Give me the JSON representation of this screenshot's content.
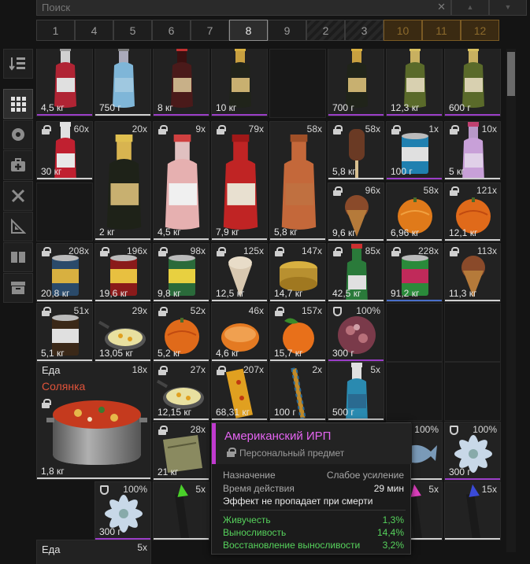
{
  "search": {
    "placeholder": "Поиск",
    "clear": "✕"
  },
  "sort_buttons": [
    "▲",
    "▼"
  ],
  "pages": [
    {
      "label": "1",
      "state": "normal"
    },
    {
      "label": "4",
      "state": "normal"
    },
    {
      "label": "5",
      "state": "normal"
    },
    {
      "label": "6",
      "state": "normal"
    },
    {
      "label": "7",
      "state": "normal"
    },
    {
      "label": "8",
      "state": "active"
    },
    {
      "label": "9",
      "state": "normal"
    },
    {
      "label": "2",
      "state": "striped"
    },
    {
      "label": "3",
      "state": "striped"
    },
    {
      "label": "10",
      "state": "locked"
    },
    {
      "label": "11",
      "state": "locked"
    },
    {
      "label": "12",
      "state": "locked"
    }
  ],
  "sidebar": [
    {
      "name": "sort-icon",
      "active": false
    },
    {
      "name": "grid-icon",
      "active": true
    },
    {
      "name": "ball-icon",
      "active": false
    },
    {
      "name": "medkit-icon",
      "active": false
    },
    {
      "name": "tools-icon",
      "active": false
    },
    {
      "name": "blueprint-icon",
      "active": false
    },
    {
      "name": "book-icon",
      "active": false
    },
    {
      "name": "storage-icon",
      "active": false
    }
  ],
  "colors": {
    "accent_purple": "#c13ad0",
    "rarity_purple": "#9b3ec8",
    "rarity_blue": "#4a6fc9",
    "rarity_white": "#d0d0d0",
    "rarity_orange": "#d27b2a",
    "positive_green": "#56d25c"
  },
  "items": [
    {
      "id": "c1",
      "weight": "4,5 кг",
      "qty": "",
      "lock": "",
      "art": "bottle-red",
      "bar": "purple"
    },
    {
      "id": "c2",
      "weight": "750 г",
      "qty": "",
      "lock": "",
      "art": "bottle-blue",
      "bar": "white"
    },
    {
      "id": "c3",
      "weight": "8 кг",
      "qty": "",
      "lock": "",
      "art": "bottle-wine",
      "bar": "purple"
    },
    {
      "id": "c4",
      "weight": "10 кг",
      "qty": "",
      "lock": "",
      "art": "bottle-gold",
      "bar": "purple"
    },
    {
      "id": "c6",
      "weight": "700 г",
      "qty": "",
      "lock": "",
      "art": "bottle-gold",
      "bar": "purple"
    },
    {
      "id": "c7",
      "weight": "12,3 кг",
      "qty": "",
      "lock": "",
      "art": "bottle-green",
      "bar": "purple"
    },
    {
      "id": "c8",
      "weight": "600 г",
      "qty": "",
      "lock": "",
      "art": "bottle-green",
      "bar": "purple"
    },
    {
      "id": "r2c1",
      "weight": "30 кг",
      "qty": "60x",
      "lock": "lock",
      "art": "sauce",
      "bar": "white"
    },
    {
      "id": "r2c2",
      "weight": "2 кг",
      "qty": "20x",
      "lock": "",
      "art": "bottle-gold-tall",
      "bar": "white"
    },
    {
      "id": "r2c3",
      "weight": "4,5 кг",
      "qty": "9x",
      "lock": "lock",
      "art": "bottle-pink",
      "bar": "white"
    },
    {
      "id": "r2c4",
      "weight": "7,9 кг",
      "qty": "79x",
      "lock": "lock",
      "art": "bottle-vodka",
      "bar": "white"
    },
    {
      "id": "r2c5",
      "weight": "5,8 кг",
      "qty": "58x",
      "lock": "",
      "art": "bottle-clay",
      "bar": "white"
    },
    {
      "id": "r2c6",
      "weight": "5,8 кг",
      "qty": "58x",
      "lock": "lock",
      "art": "popsicle",
      "bar": "white"
    },
    {
      "id": "r2c7",
      "weight": "100 г",
      "qty": "1x",
      "lock": "lock",
      "art": "can-blue",
      "bar": "purple"
    },
    {
      "id": "r2c8",
      "weight": "5 кг",
      "qty": "10x",
      "lock": "lock",
      "art": "bottle-lilac",
      "bar": "white"
    },
    {
      "id": "r3c6",
      "weight": "9,6 кг",
      "qty": "96x",
      "lock": "lock",
      "art": "icecream",
      "bar": "white"
    },
    {
      "id": "r3c7",
      "weight": "6,96 кг",
      "qty": "58x",
      "lock": "",
      "art": "orange-big",
      "bar": "white"
    },
    {
      "id": "r3c8",
      "weight": "12,1 кг",
      "qty": "121x",
      "lock": "lock",
      "art": "tangerine",
      "bar": "white"
    },
    {
      "id": "r4c1",
      "weight": "20,8 кг",
      "qty": "208x",
      "lock": "lock",
      "art": "can-beans",
      "bar": "white"
    },
    {
      "id": "r4c2",
      "weight": "19,6 кг",
      "qty": "196x",
      "lock": "lock",
      "art": "can-red",
      "bar": "white"
    },
    {
      "id": "r4c3",
      "weight": "9,8 кг",
      "qty": "98x",
      "lock": "lock",
      "art": "can-green",
      "bar": "white"
    },
    {
      "id": "r4c4",
      "weight": "12,5 кг",
      "qty": "125x",
      "lock": "lock",
      "art": "cone",
      "bar": "white"
    },
    {
      "id": "r4c5",
      "weight": "14,7 кг",
      "qty": "147x",
      "lock": "lock",
      "art": "tin",
      "bar": "white"
    },
    {
      "id": "r4c6",
      "weight": "42,5 кг",
      "qty": "85x",
      "lock": "lock",
      "art": "bottle-water",
      "bar": "white"
    },
    {
      "id": "r4c7",
      "weight": "91,2 кг",
      "qty": "228x",
      "lock": "lock",
      "art": "can-mix",
      "bar": "blue"
    },
    {
      "id": "r4c8",
      "weight": "11,3 кг",
      "qty": "113x",
      "lock": "lock",
      "art": "icecream",
      "bar": "white"
    },
    {
      "id": "r5c1",
      "weight": "5,1 кг",
      "qty": "51x",
      "lock": "lock",
      "art": "can-stark",
      "bar": "white"
    },
    {
      "id": "r5c2",
      "weight": "13,05 кг",
      "qty": "29x",
      "lock": "",
      "art": "pan-eggs",
      "bar": "white"
    },
    {
      "id": "r5c3",
      "weight": "5,2 кг",
      "qty": "52x",
      "lock": "lock",
      "art": "tangerine",
      "bar": "white"
    },
    {
      "id": "r5c4",
      "weight": "4,6 кг",
      "qty": "46x",
      "lock": "",
      "art": "tangerine-half",
      "bar": "white"
    },
    {
      "id": "r5c5",
      "weight": "15,7 кг",
      "qty": "157x",
      "lock": "lock",
      "art": "tangerine-leaf",
      "bar": "white"
    },
    {
      "id": "r5c6",
      "weight": "300 г",
      "qty": "100%",
      "lock": "shield",
      "art": "flower-red",
      "bar": "purple"
    },
    {
      "id": "r6c3",
      "weight": "12,15 кг",
      "qty": "27x",
      "lock": "lock",
      "art": "pan-eggs",
      "bar": "white"
    },
    {
      "id": "r6c4",
      "weight": "68,31 кг",
      "qty": "207x",
      "lock": "lock",
      "art": "fries",
      "bar": "white"
    },
    {
      "id": "r6c5",
      "weight": "100 г",
      "qty": "2x",
      "lock": "",
      "art": "stick",
      "bar": "white"
    },
    {
      "id": "r6c6",
      "weight": "500 г",
      "qty": "5x",
      "lock": "",
      "art": "bottle-cleaner",
      "bar": "white"
    },
    {
      "id": "r7c3",
      "weight": "21 кг",
      "qty": "28x",
      "lock": "lock",
      "art": "mre",
      "bar": "white"
    },
    {
      "id": "r7c7",
      "weight": "",
      "qty": "100%",
      "lock": "",
      "art": "fish",
      "bar": "white"
    },
    {
      "id": "r7c8",
      "weight": "300 г",
      "qty": "100%",
      "lock": "shield",
      "art": "flower-white",
      "bar": "purple"
    },
    {
      "id": "r8c2",
      "weight": "300 г",
      "qty": "100%",
      "lock": "shield",
      "art": "flower-white",
      "bar": "purple"
    },
    {
      "id": "r8c3",
      "weight": "",
      "qty": "5x",
      "lock": "",
      "art": "firework-green",
      "bar": "white"
    },
    {
      "id": "r8c7",
      "weight": "",
      "qty": "5x",
      "lock": "",
      "art": "firework-pink",
      "bar": "white"
    },
    {
      "id": "r8c8",
      "weight": "",
      "qty": "15x",
      "lock": "",
      "art": "firework-blue",
      "bar": "white"
    }
  ],
  "big_item": {
    "category": "Еда",
    "name": "Солянка",
    "qty": "18x",
    "weight": "1,8 кг"
  },
  "bottom_item": {
    "category": "Еда",
    "qty": "5x"
  },
  "tooltip": {
    "title": "Американский ИРП",
    "subtitle": "Персональный предмет",
    "rows": [
      {
        "label": "Назначение",
        "value": "Слабое усиление",
        "style": "dim"
      },
      {
        "label": "Время действия",
        "value": "29 мин",
        "style": "dim"
      },
      {
        "label": "Эффект не пропадает при смерти",
        "value": "",
        "style": "white"
      },
      {
        "label": "Живучесть",
        "value": "1,3%",
        "style": "green"
      },
      {
        "label": "Выносливость",
        "value": "14,4%",
        "style": "green"
      },
      {
        "label": "Восстановление выносливости",
        "value": "3,2%",
        "style": "green"
      }
    ]
  }
}
